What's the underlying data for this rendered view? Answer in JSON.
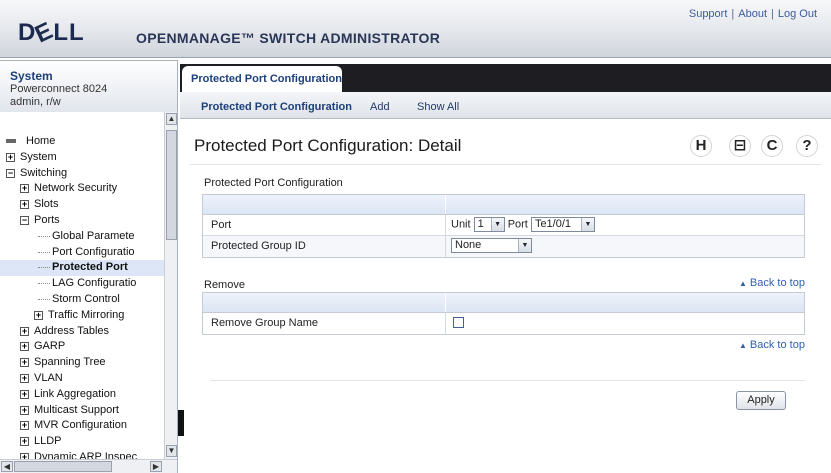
{
  "header": {
    "logo_text": "DELL",
    "product_title": "OPENMANAGE™ SWITCH ADMINISTRATOR",
    "links": [
      "Support",
      "About",
      "Log Out"
    ]
  },
  "system": {
    "title": "System",
    "model": "Powerconnect 8024",
    "user": "admin, r/w"
  },
  "nav": {
    "items": [
      {
        "label": "Home",
        "indent": 0,
        "expander": "",
        "selected": false
      },
      {
        "label": "System",
        "indent": 0,
        "expander": "+",
        "selected": false
      },
      {
        "label": "Switching",
        "indent": 0,
        "expander": "−",
        "selected": false
      },
      {
        "label": "Network Security",
        "indent": 1,
        "expander": "+",
        "selected": false
      },
      {
        "label": "Slots",
        "indent": 1,
        "expander": "+",
        "selected": false
      },
      {
        "label": "Ports",
        "indent": 1,
        "expander": "−",
        "selected": false
      },
      {
        "label": "Global Paramete",
        "indent": 2,
        "expander": "",
        "selected": false
      },
      {
        "label": "Port Configuratio",
        "indent": 2,
        "expander": "",
        "selected": false
      },
      {
        "label": "Protected Port",
        "indent": 2,
        "expander": "",
        "selected": true
      },
      {
        "label": "LAG Configuratio",
        "indent": 2,
        "expander": "",
        "selected": false
      },
      {
        "label": "Storm Control",
        "indent": 2,
        "expander": "",
        "selected": false
      },
      {
        "label": "Traffic Mirroring",
        "indent": 2,
        "expander": "+",
        "selected": false
      },
      {
        "label": "Address Tables",
        "indent": 1,
        "expander": "+",
        "selected": false
      },
      {
        "label": "GARP",
        "indent": 1,
        "expander": "+",
        "selected": false
      },
      {
        "label": "Spanning Tree",
        "indent": 1,
        "expander": "+",
        "selected": false
      },
      {
        "label": "VLAN",
        "indent": 1,
        "expander": "+",
        "selected": false
      },
      {
        "label": "Link Aggregation",
        "indent": 1,
        "expander": "+",
        "selected": false
      },
      {
        "label": "Multicast Support",
        "indent": 1,
        "expander": "+",
        "selected": false
      },
      {
        "label": "MVR Configuration",
        "indent": 1,
        "expander": "+",
        "selected": false
      },
      {
        "label": "LLDP",
        "indent": 1,
        "expander": "+",
        "selected": false
      },
      {
        "label": "Dynamic ARP Inspec",
        "indent": 1,
        "expander": "+",
        "selected": false
      }
    ]
  },
  "tabs": {
    "main": "Protected Port Configuration",
    "sub": [
      "Protected Port Configuration",
      "Add",
      "Show All"
    ]
  },
  "page": {
    "title": "Protected Port Configuration: Detail",
    "tool_icons": [
      "save-icon",
      "print-icon",
      "refresh-icon",
      "help-icon"
    ],
    "tool_glyphs": [
      "H",
      "⊟",
      "C",
      "?"
    ]
  },
  "config": {
    "section_title": "Protected Port Configuration",
    "port_label": "Port",
    "unit_label": "Unit",
    "unit_value": "1",
    "port_word": "Port",
    "port_value": "Te1/0/1",
    "group_label": "Protected Group ID",
    "group_value": "None"
  },
  "remove": {
    "section_title": "Remove",
    "back_to_top": "Back to top",
    "group_name_label": "Remove Group Name",
    "checked": false,
    "back_to_top_bottom": "Back to top"
  },
  "actions": {
    "apply": "Apply"
  }
}
